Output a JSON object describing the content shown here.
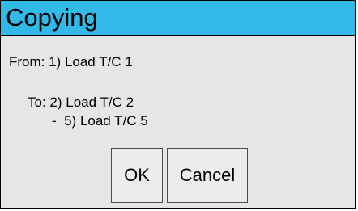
{
  "dialog": {
    "title": "Copying",
    "from_line": "From: 1) Load T/C 1",
    "to_line": "To: 2) Load T/C 2",
    "range_line": "-  5) Load T/C 5"
  },
  "buttons": {
    "ok_label": "OK",
    "cancel_label": "Cancel"
  },
  "colors": {
    "title_bar": "#32b9e8",
    "dialog_background": "#e6e6e6"
  }
}
